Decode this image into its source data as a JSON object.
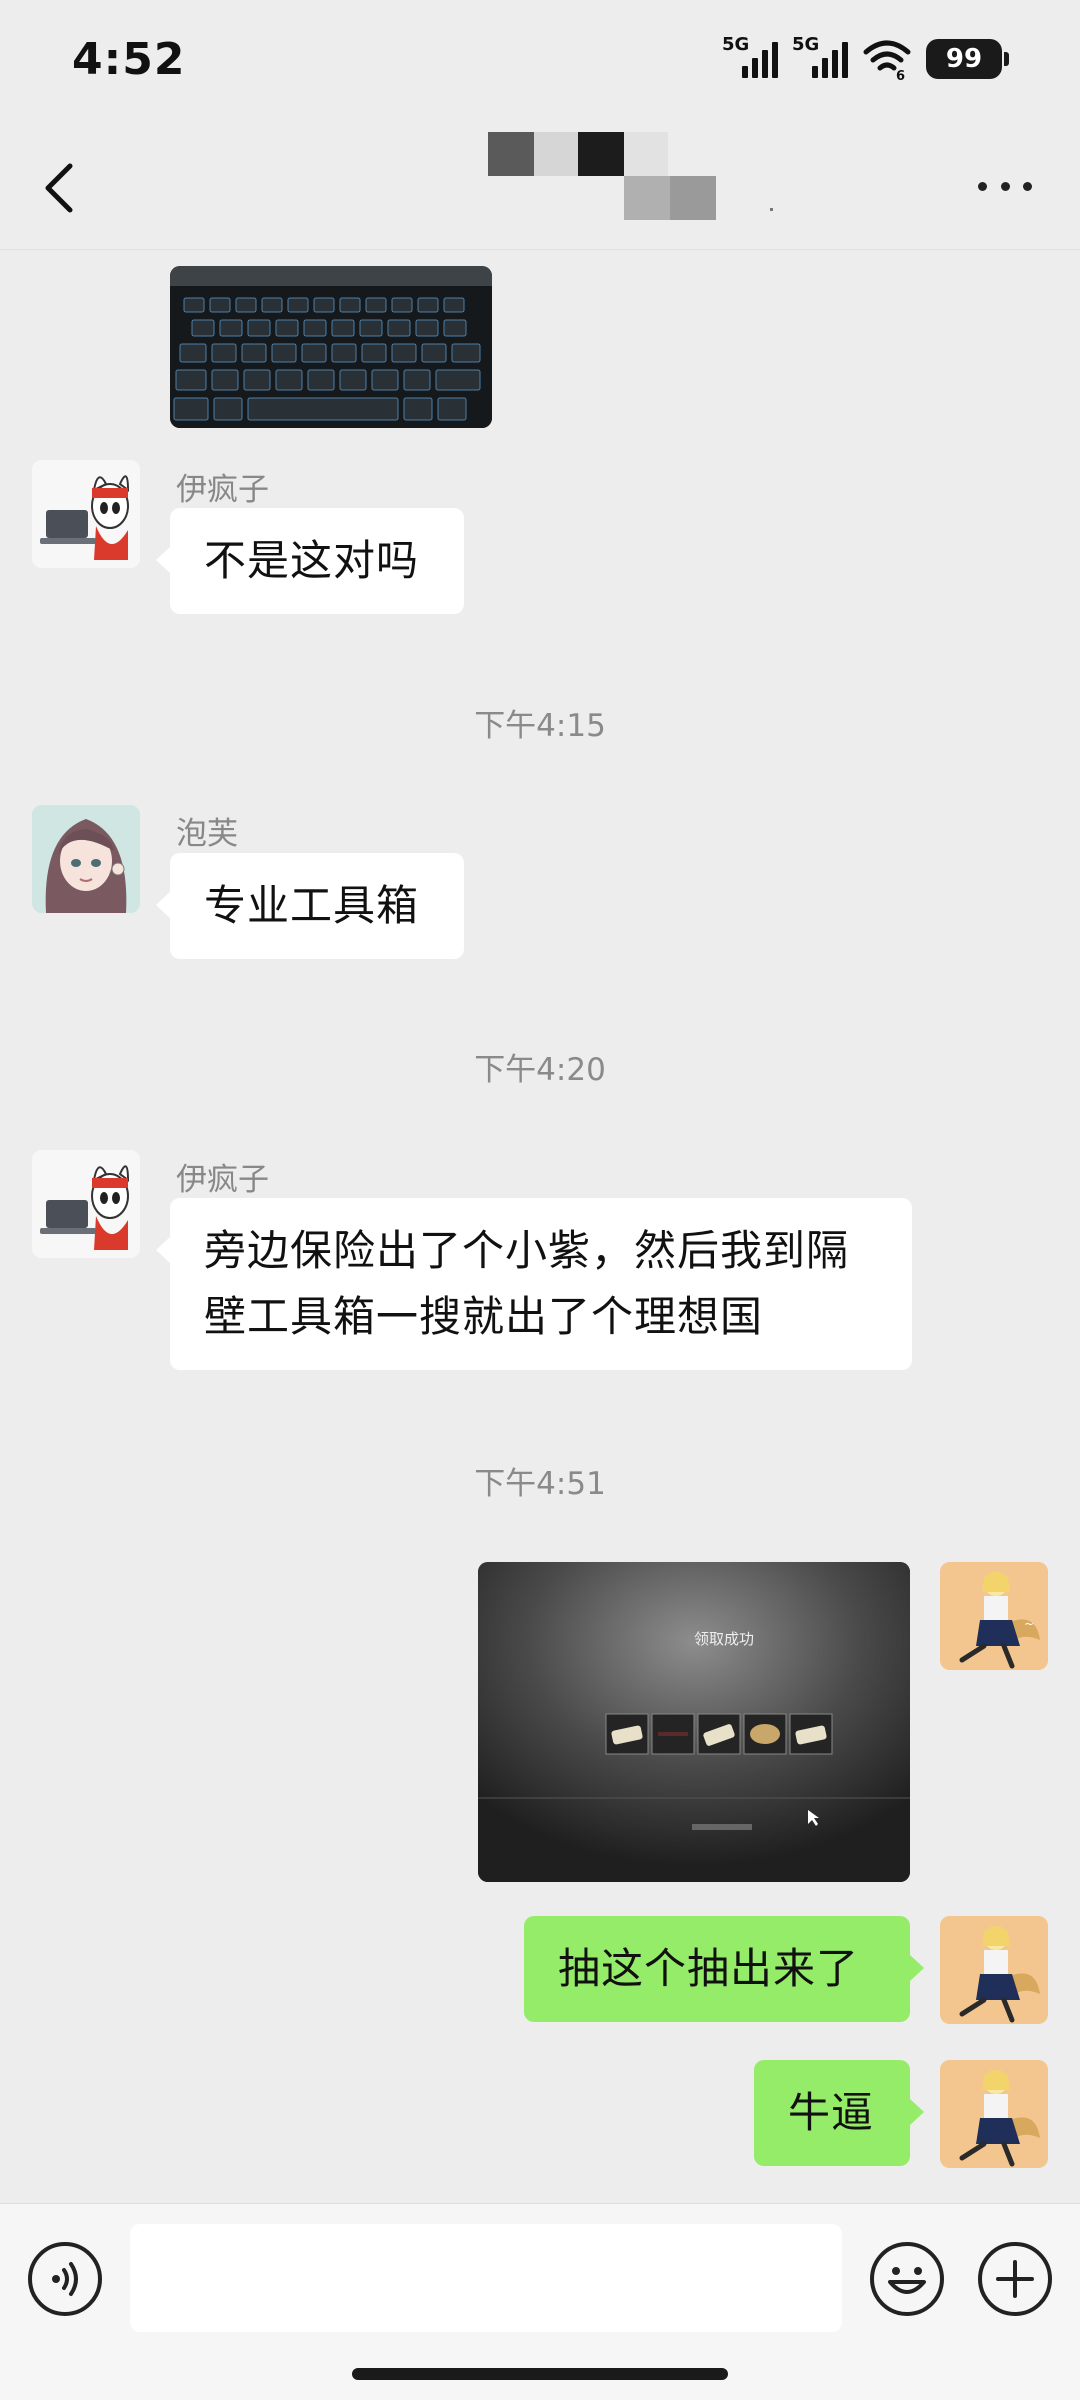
{
  "status_bar": {
    "time": "4:52",
    "signal1_label": "5G",
    "signal2_label": "5G",
    "wifi_badge": "6",
    "battery": "99"
  },
  "nav": {
    "back_icon": "chevron-left-icon",
    "title_obscured": true,
    "more_icon": "more-dots-icon"
  },
  "messages": [
    {
      "type": "image",
      "direction": "in",
      "description_icon": "keyboard-photo"
    },
    {
      "type": "text",
      "direction": "in",
      "sender": "伊疯子",
      "text": "不是这对吗"
    },
    {
      "type": "time",
      "text": "下午4:15"
    },
    {
      "type": "text",
      "direction": "in",
      "sender": "泡芙",
      "text": "专业工具箱"
    },
    {
      "type": "time",
      "text": "下午4:20"
    },
    {
      "type": "text",
      "direction": "in",
      "sender": "伊疯子",
      "text": "旁边保险出了个小紫，然后我到隔壁工具箱一搜就出了个理想国"
    },
    {
      "type": "time",
      "text": "下午4:51"
    },
    {
      "type": "image",
      "direction": "out",
      "caption": "领取成功"
    },
    {
      "type": "text",
      "direction": "out",
      "text": "抽这个抽出来了"
    },
    {
      "type": "text",
      "direction": "out",
      "text": "牛逼"
    }
  ],
  "input_bar": {
    "voice_icon": "voice-icon",
    "emoji_icon": "emoji-icon",
    "add_icon": "plus-icon",
    "text_value": ""
  },
  "colors": {
    "background": "#ededed",
    "bubble_out": "#95ec69",
    "bubble_in": "#ffffff",
    "timestamp": "#8a8a8a"
  }
}
